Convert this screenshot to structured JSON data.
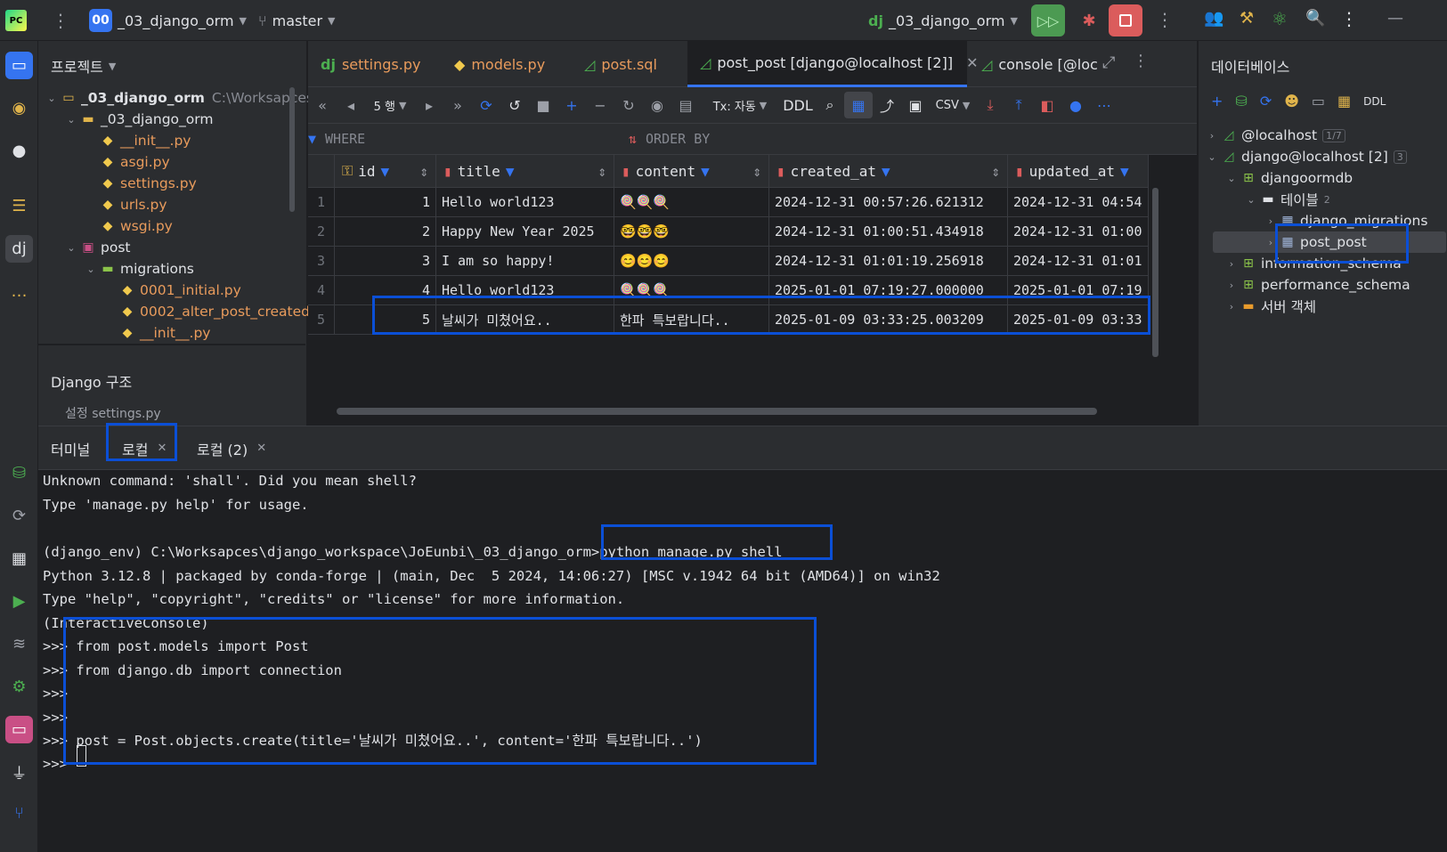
{
  "titlebar": {
    "project_badge": "00",
    "project_name": "_03_django_orm",
    "branch": "master",
    "run_config": "_03_django_orm"
  },
  "project_panel": {
    "title": "프로젝트",
    "root_name": "_03_django_orm",
    "root_path": "C:\\Worksapces",
    "items": [
      {
        "label": "_03_django_orm",
        "icon": "folder-icon"
      },
      {
        "label": "__init__.py",
        "icon": "python-file-icon"
      },
      {
        "label": "asgi.py",
        "icon": "python-file-icon"
      },
      {
        "label": "settings.py",
        "icon": "python-file-icon"
      },
      {
        "label": "urls.py",
        "icon": "python-file-icon"
      },
      {
        "label": "wsgi.py",
        "icon": "python-file-icon"
      },
      {
        "label": "post",
        "icon": "package-icon"
      },
      {
        "label": "migrations",
        "icon": "folder-icon"
      },
      {
        "label": "0001_initial.py",
        "icon": "python-file-icon"
      },
      {
        "label": "0002_alter_post_created",
        "icon": "python-file-icon"
      },
      {
        "label": "__init__.py",
        "icon": "python-file-icon"
      }
    ],
    "structure_title": "Django 구조",
    "structure_item": "설정  settings.py"
  },
  "editor": {
    "tabs": [
      {
        "label": "settings.py"
      },
      {
        "label": "models.py"
      },
      {
        "label": "post.sql"
      },
      {
        "label": "post_post [django@localhost [2]]"
      },
      {
        "label": "console [@loc"
      }
    ],
    "toolbar": {
      "rows_label": "5 행",
      "tx_label": "Tx: 자동",
      "ddl_label": "DDL",
      "csv_label": "CSV"
    },
    "filter": {
      "where": "WHERE",
      "order_by": "ORDER BY"
    },
    "columns": [
      "id",
      "title",
      "content",
      "created_at",
      "updated_at"
    ],
    "rows": [
      {
        "n": "1",
        "id": "1",
        "title": "Hello world123",
        "content": "🍭🍭🍭",
        "created_at": "2024-12-31 00:57:26.621312",
        "updated_at": "2024-12-31 04:54"
      },
      {
        "n": "2",
        "id": "2",
        "title": "Happy New Year 2025",
        "content": "🤓🤓🤓",
        "created_at": "2024-12-31 01:00:51.434918",
        "updated_at": "2024-12-31 01:00"
      },
      {
        "n": "3",
        "id": "3",
        "title": "I am so happy!",
        "content": "😊😊😊",
        "created_at": "2024-12-31 01:01:19.256918",
        "updated_at": "2024-12-31 01:01"
      },
      {
        "n": "4",
        "id": "4",
        "title": "Hello world123",
        "content": "🍭🍭🍭",
        "created_at": "2025-01-01 07:19:27.000000",
        "updated_at": "2025-01-01 07:19"
      },
      {
        "n": "5",
        "id": "5",
        "title": "날씨가 미쳤어요..",
        "content": "한파 특보랍니다..",
        "created_at": "2025-01-09 03:33:25.003209",
        "updated_at": "2025-01-09 03:33"
      }
    ]
  },
  "db_panel": {
    "title": "데이터베이스",
    "ddl": "DDL",
    "tree": {
      "localhost": "@localhost",
      "localhost_count": "1/7",
      "django": "django@localhost [2]",
      "django_count": "3",
      "schema": "djangoormdb",
      "tables": "테이블",
      "tables_count": "2",
      "table1": "django_migrations",
      "table2": "post_post",
      "info": "information_schema",
      "perf": "performance_schema",
      "server": "서버 객체"
    }
  },
  "terminal": {
    "title": "터미널",
    "tabs": [
      {
        "label": "로컬"
      },
      {
        "label": "로컬 (2)"
      }
    ],
    "lines": [
      "Unknown command: 'shall'. Did you mean shell?",
      "Type 'manage.py help' for usage.",
      "",
      "(django_env) C:\\Worksapces\\django_workspace\\JoEunbi\\_03_django_orm>python manage.py shell",
      "Python 3.12.8 | packaged by conda-forge | (main, Dec  5 2024, 14:06:27) [MSC v.1942 64 bit (AMD64)] on win32",
      "Type \"help\", \"copyright\", \"credits\" or \"license\" for more information.",
      "(InteractiveConsole)",
      ">>> from post.models import Post",
      ">>> from django.db import connection",
      ">>>",
      ">>>",
      ">>> post = Post.objects.create(title='날씨가 미쳤어요..', content='한파 특보랍니다..')",
      ">>> "
    ]
  },
  "colors": {
    "accent": "#3574f0",
    "highlight_box": "#0b4fd6",
    "run_green": "#4c9a52",
    "stop_red": "#db5c5c"
  }
}
